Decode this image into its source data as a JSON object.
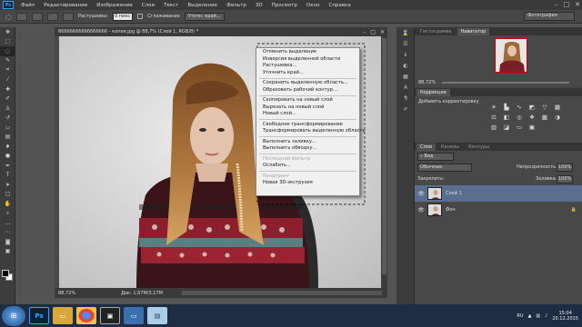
{
  "menubar": {
    "app_badge": "Ps",
    "items": [
      "Файл",
      "Редактирование",
      "Изображение",
      "Слои",
      "Текст",
      "Выделение",
      "Фильтр",
      "3D",
      "Просмотр",
      "Окно",
      "Справка"
    ]
  },
  "options": {
    "feather_label": "Растушевка:",
    "feather_value": "0 пикс",
    "antialias_label": "Сглаживание",
    "refine_edge": "Уточн. край...",
    "workspace": "Фотография"
  },
  "document": {
    "title": "66666666666666666 - копия.jpg @ 88,7% (Слой 1, RGB/8) *",
    "zoom": "88,72%",
    "doc_info": "Док: 1,67М/3,17М"
  },
  "context_menu": {
    "groups": [
      [
        "Отменить выделение",
        "Инверсия выделенной области",
        "Растушевка...",
        "Уточнить край..."
      ],
      [
        "Сохранить выделенную область...",
        "Образовать рабочий контур..."
      ],
      [
        "Скопировать на новый слой",
        "Вырезать на новый слой",
        "Новый слой..."
      ],
      [
        "Свободное трансформирование",
        "Трансформировать выделенную область"
      ],
      [
        "Выполнить заливку...",
        "Выполнить обводку..."
      ],
      [
        "Последний фильтр",
        "Ослабить..."
      ],
      [
        "Рендеринг",
        "Новая 3D-экструзия"
      ]
    ],
    "disabled": [
      "Последний фильтр",
      "Рендеринг"
    ]
  },
  "panels": {
    "nav_tabs": [
      "Гистограмма",
      "Навигатор"
    ],
    "nav_zoom": "88,72%",
    "corrections_title": "Коррекция",
    "corrections_subtitle": "Добавить корректировку",
    "layer_tabs": [
      "Слои",
      "Каналы",
      "Контуры"
    ],
    "filter_kind": "Вид",
    "blend_mode": "Обычные",
    "opacity_label": "Непрозрачность:",
    "opacity_value": "100%",
    "lock_label": "Закрепить:",
    "fill_label": "Заливка:",
    "fill_value": "100%",
    "layers": [
      {
        "name": "Слой 1",
        "selected": true
      },
      {
        "name": "Фон",
        "selected": false
      }
    ]
  },
  "taskbar": {
    "lang": "RU",
    "time": "15:04",
    "date": "20.12.2015"
  },
  "colors": {
    "accent_selection": "#5a6f8f",
    "ps_blue": "#31a8ff"
  }
}
